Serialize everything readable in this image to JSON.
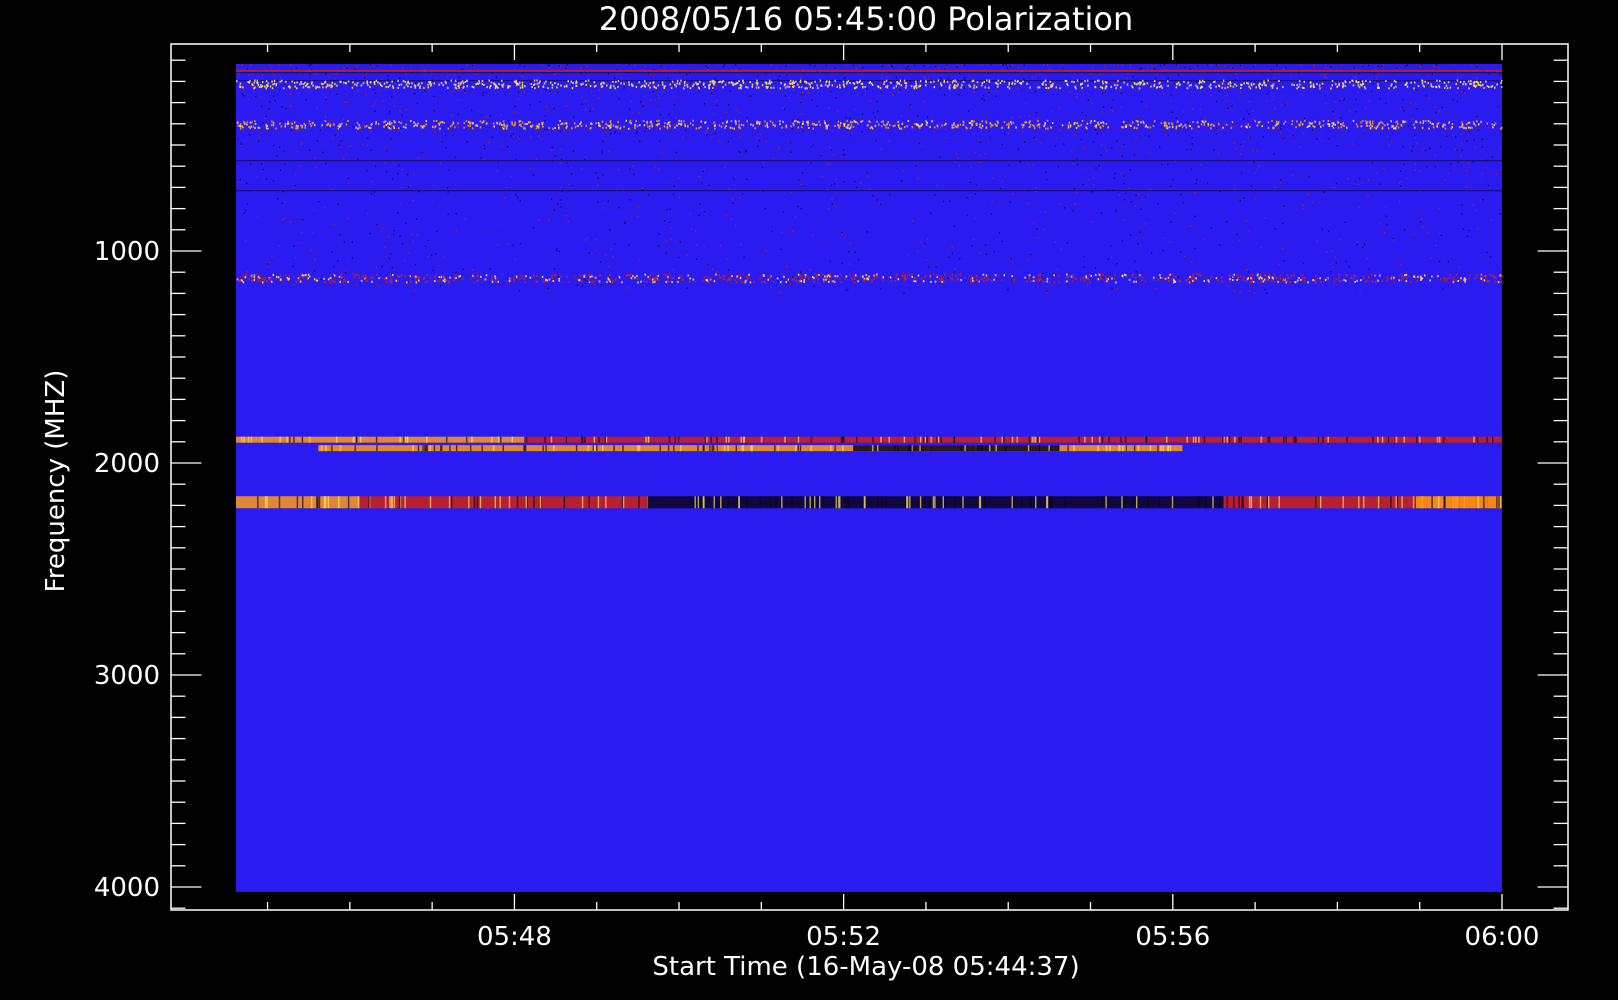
{
  "chart_data": {
    "type": "heatmap",
    "title": "2008/05/16 05:45:00 Polarization",
    "xlabel": "Start Time (16-May-08 05:44:37)",
    "ylabel": "Frequency (MHZ)",
    "x_tick_labels": [
      "05:48",
      "05:52",
      "05:56",
      "06:00"
    ],
    "x_tick_values_min": [
      3.3833,
      7.3833,
      11.3833,
      15.3833
    ],
    "x_range_min": [
      0,
      15.3833
    ],
    "x_minor_step_min": 1,
    "y_tick_labels": [
      "1000",
      "2000",
      "3000",
      "4000"
    ],
    "y_tick_values": [
      1000,
      2000,
      3000,
      4000
    ],
    "y_minor_step": 100,
    "y_range": [
      100,
      4000
    ],
    "ylim": [
      4130,
      0
    ],
    "y_inverted": true,
    "colors": {
      "background": "#000000",
      "axis": "#ffffff",
      "base": "#2a1cf0",
      "dark": "#0a0420",
      "red": "#d02010",
      "orange": "#ff9a10",
      "yellow": "#ffe060"
    },
    "features": [
      {
        "kind": "line",
        "freq": 150,
        "t_start": 0,
        "t_end": 15.38,
        "color": "red"
      },
      {
        "kind": "noise",
        "freq": 210,
        "t_start": 0,
        "t_end": 15.38,
        "color": "yellow"
      },
      {
        "kind": "noise",
        "freq": 400,
        "t_start": 0,
        "t_end": 15.38,
        "color": "orange"
      },
      {
        "kind": "noise",
        "freq": 1125,
        "t_start": 0,
        "t_end": 15.38,
        "color": "red"
      },
      {
        "kind": "band",
        "freq": 1890,
        "t_start": 0,
        "t_end": 3.5,
        "color": "orange"
      },
      {
        "kind": "band",
        "freq": 1890,
        "t_start": 3.5,
        "t_end": 15.38,
        "color": "red"
      },
      {
        "kind": "band",
        "freq": 1930,
        "t_start": 1.0,
        "t_end": 11.5,
        "color": "orange"
      },
      {
        "kind": "band",
        "freq": 1930,
        "t_start": 7.5,
        "t_end": 10.0,
        "color": "dark"
      },
      {
        "kind": "band",
        "freq": 2185,
        "t_start": 0,
        "t_end": 1.5,
        "color": "orange"
      },
      {
        "kind": "band",
        "freq": 2185,
        "t_start": 1.5,
        "t_end": 5.0,
        "color": "red"
      },
      {
        "kind": "band",
        "freq": 2185,
        "t_start": 5.0,
        "t_end": 12.0,
        "color": "dark"
      },
      {
        "kind": "band",
        "freq": 2185,
        "t_start": 12.0,
        "t_end": 15.38,
        "color": "red"
      },
      {
        "kind": "band",
        "freq": 2185,
        "t_start": 14.3,
        "t_end": 15.38,
        "color": "orange"
      }
    ]
  }
}
